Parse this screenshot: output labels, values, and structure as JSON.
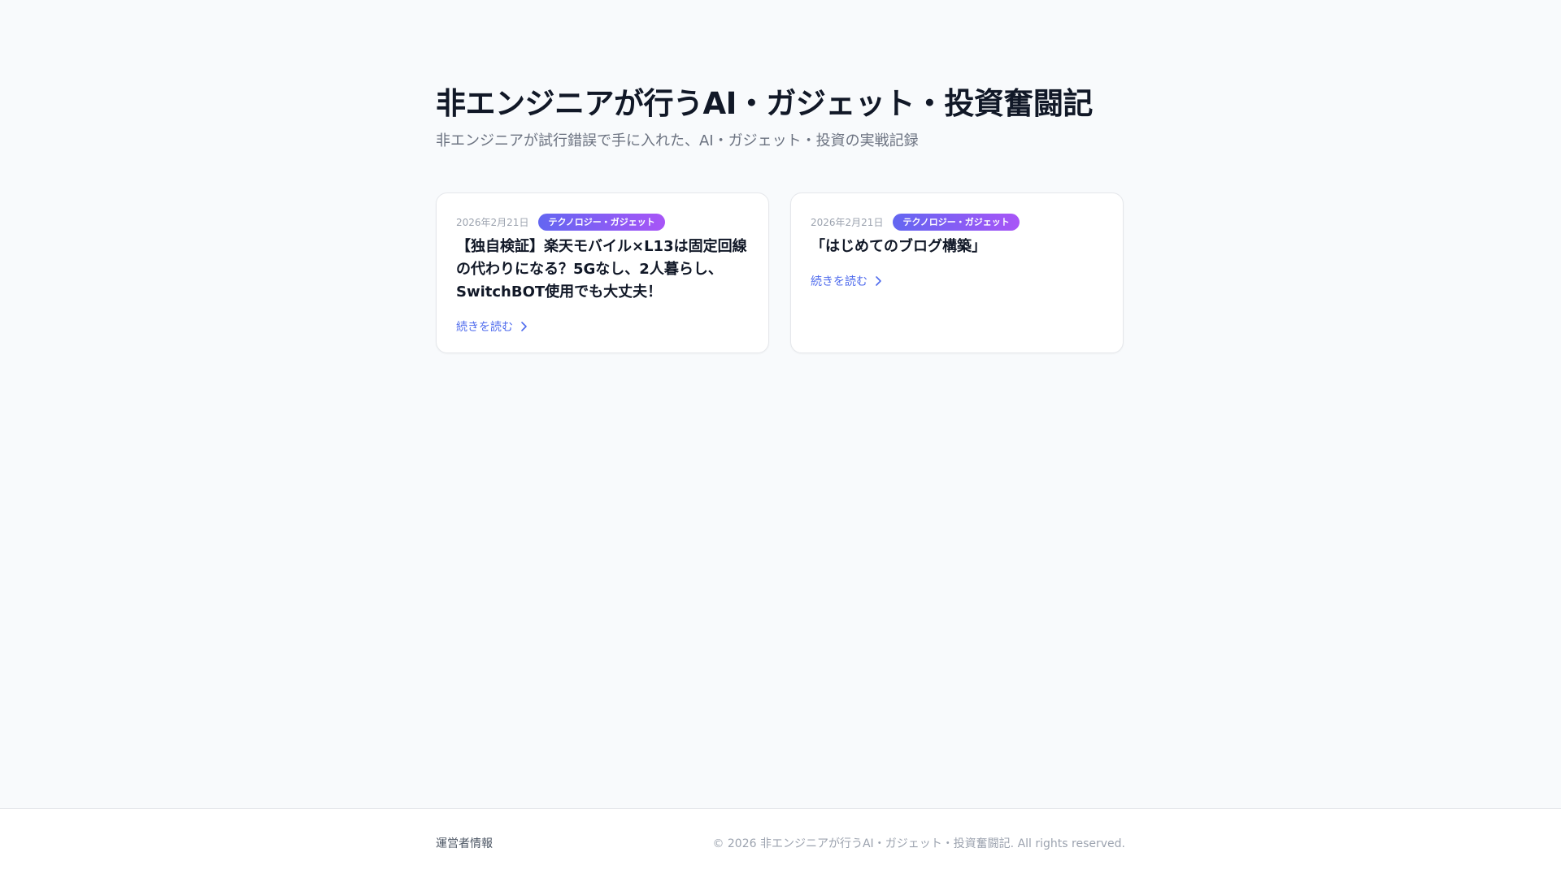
{
  "header": {
    "title": "非エンジニアが行うAI・ガジェット・投資奮闘記",
    "subtitle": "非エンジニアが試行錯誤で手に入れた、AI・ガジェット・投資の実戦記録"
  },
  "posts": [
    {
      "date": "2026年2月21日",
      "category": "テクノロジー・ガジェット",
      "title": "【独自検証】楽天モバイル×L13は固定回線の代わりになる？5Gなし、2人暮らし、SwitchBOT使用でも大丈夫！",
      "read_more": "続きを読む",
      "chevron_icon": "chevron-right-icon"
    },
    {
      "date": "2026年2月21日",
      "category": "テクノロジー・ガジェット",
      "title": "「はじめてのブログ構築」",
      "read_more": "続きを読む",
      "chevron_icon": "chevron-right-icon"
    }
  ],
  "footer": {
    "operator_link": "運営者情報",
    "copyright": "© 2026 非エンジニアが行うAI・ガジェット・投資奮闘記. All rights reserved."
  },
  "colors": {
    "background": "#f8fafc",
    "accent_link": "#4f6bed",
    "badge_gradient_start": "#6366f1",
    "badge_gradient_end": "#a855f7"
  }
}
